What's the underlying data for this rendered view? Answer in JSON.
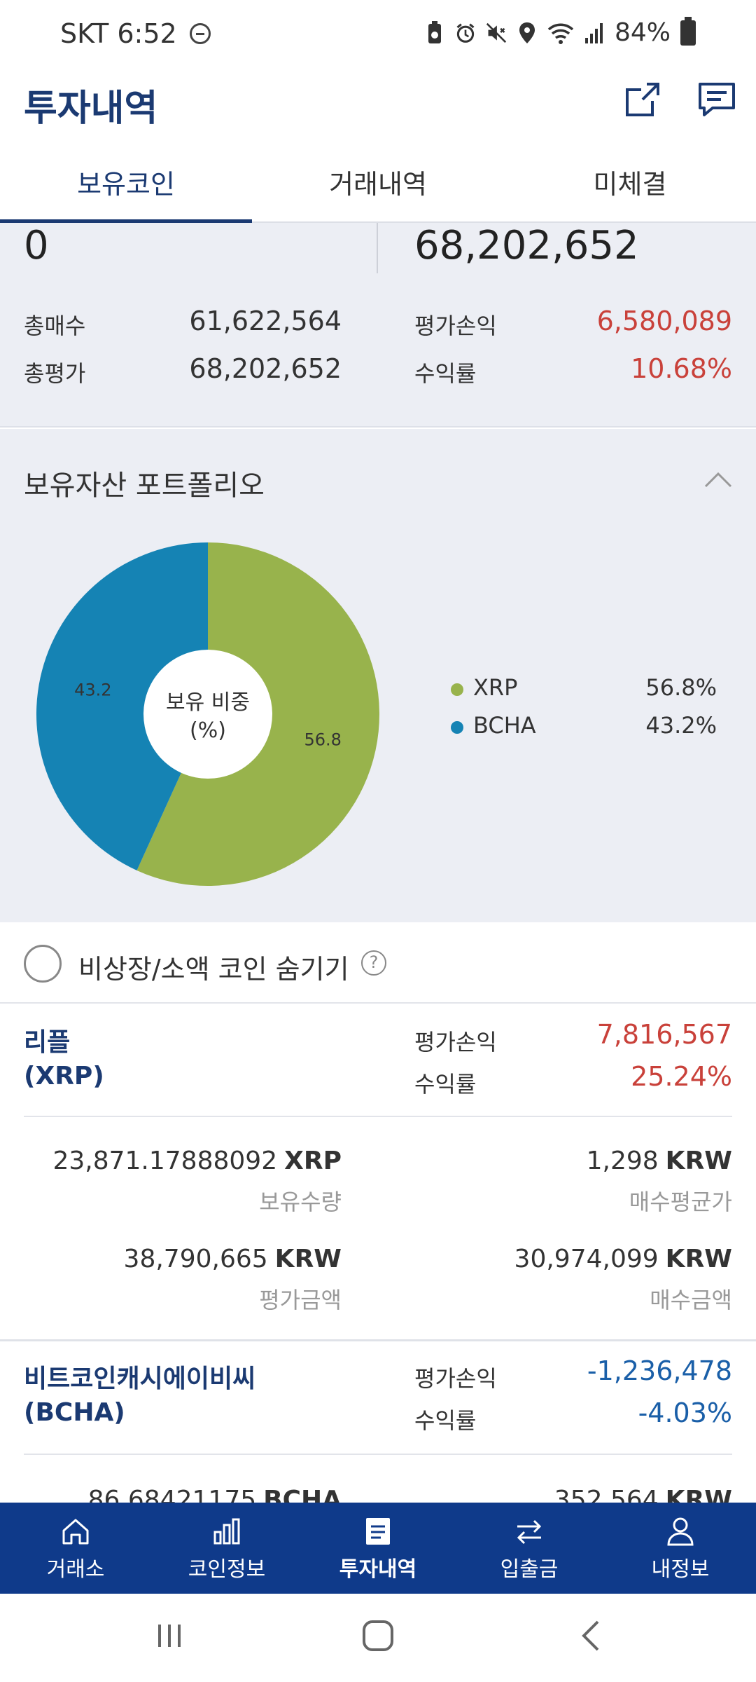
{
  "status_bar": {
    "carrier_time": "SKT 6:52",
    "battery": "84%"
  },
  "header": {
    "title": "투자내역"
  },
  "tabs": [
    {
      "label": "보유코인",
      "active": true
    },
    {
      "label": "거래내역",
      "active": false
    },
    {
      "label": "미체결",
      "active": false
    }
  ],
  "summary": {
    "left_big": "0",
    "right_big": "68,202,652",
    "total_buy_label": "총매수",
    "total_buy": "61,622,564",
    "total_eval_label": "총평가",
    "total_eval": "68,202,652",
    "pnl_label": "평가손익",
    "pnl": "6,580,089",
    "yield_label": "수익률",
    "yield": "10.68%"
  },
  "portfolio": {
    "title": "보유자산 포트폴리오",
    "center_label_line1": "보유 비중",
    "center_label_line2": "(%)",
    "colors": {
      "XRP": "#98b34c",
      "BCHA": "#1583b4"
    },
    "legend": [
      {
        "name": "XRP",
        "pct": "56.8%"
      },
      {
        "name": "BCHA",
        "pct": "43.2%"
      }
    ]
  },
  "chart_data": {
    "type": "pie",
    "categories": [
      "XRP",
      "BCHA"
    ],
    "values": [
      56.8,
      43.2
    ],
    "data_labels": [
      "56.8",
      "43.2"
    ],
    "donut": true
  },
  "hide_option": {
    "label": "비상장/소액 코인 숨기기",
    "help": "?"
  },
  "coins": [
    {
      "name_line1": "리플",
      "name_line2": "(XRP)",
      "pnl_label": "평가손익",
      "pnl": "7,816,567",
      "yield_label": "수익률",
      "yield": "25.24%",
      "holding_amount": "23,871.17888092",
      "holding_unit": "XRP",
      "holding_label": "보유수량",
      "avg_price": "1,298",
      "avg_price_unit": "KRW",
      "avg_price_label": "매수평균가",
      "eval_amount": "38,790,665",
      "eval_unit": "KRW",
      "eval_label": "평가금액",
      "buy_amount": "30,974,099",
      "buy_unit": "KRW",
      "buy_label": "매수금액"
    },
    {
      "name_line1": "비트코인캐시에이비씨",
      "name_line2": "(BCHA)",
      "pnl_label": "평가손익",
      "pnl": "-1,236,478",
      "yield_label": "수익률",
      "yield": "-4.03%",
      "holding_amount": "86.68421175",
      "holding_unit": "BCHA",
      "avg_price": "352,564",
      "avg_price_unit": "KRW"
    }
  ],
  "bottom_nav": [
    {
      "label": "거래소",
      "icon": "home-icon"
    },
    {
      "label": "코인정보",
      "icon": "bar-chart-icon"
    },
    {
      "label": "투자내역",
      "icon": "document-icon",
      "active": true
    },
    {
      "label": "입출금",
      "icon": "transfer-icon"
    },
    {
      "label": "내정보",
      "icon": "person-icon"
    }
  ]
}
